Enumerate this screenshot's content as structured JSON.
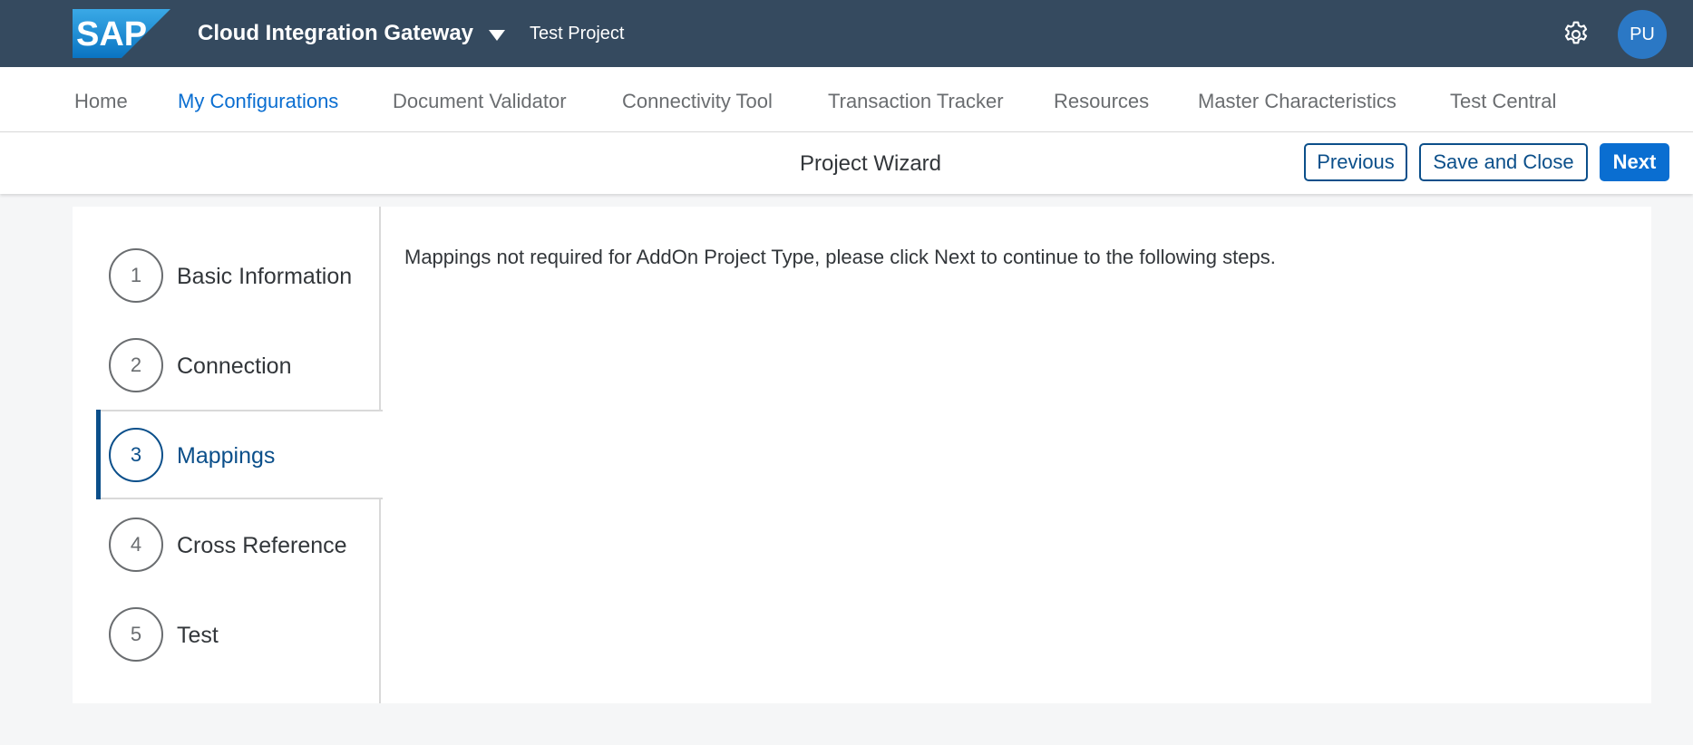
{
  "shell": {
    "logo_text": "SAP",
    "app_title": "Cloud Integration Gateway",
    "project_name": "Test Project",
    "avatar_initials": "PU",
    "colors": {
      "shell_bg": "#354a5f",
      "logo_blue": "#1a8fd7",
      "avatar_bg": "#2b78c5"
    }
  },
  "nav": {
    "items": [
      {
        "label": "Home"
      },
      {
        "label": "My Configurations",
        "active": true
      },
      {
        "label": "Document Validator"
      },
      {
        "label": "Connectivity Tool"
      },
      {
        "label": "Transaction Tracker"
      },
      {
        "label": "Resources"
      },
      {
        "label": "Master Characteristics"
      },
      {
        "label": "Test Central"
      }
    ]
  },
  "wizard": {
    "title": "Project Wizard",
    "previous_label": "Previous",
    "save_close_label": "Save and Close",
    "next_label": "Next",
    "steps": [
      {
        "number": "1",
        "label": "Basic Information"
      },
      {
        "number": "2",
        "label": "Connection"
      },
      {
        "number": "3",
        "label": "Mappings",
        "active": true
      },
      {
        "number": "4",
        "label": "Cross Reference"
      },
      {
        "number": "5",
        "label": "Test"
      }
    ],
    "message": "Mappings not required for AddOn Project Type, please click Next to continue to the following steps."
  },
  "icons": {
    "logo": "sap-logo",
    "caret": "caret-down-icon",
    "settings": "gear-icon"
  }
}
